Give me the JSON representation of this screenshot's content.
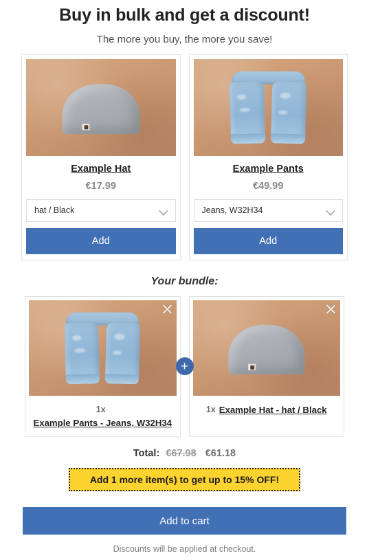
{
  "header": {
    "title": "Buy in bulk and get a discount!",
    "subtitle": "The more you buy, the more you save!"
  },
  "offers": [
    {
      "name": "Example Hat",
      "price": "€17.99",
      "variant": "hat / Black",
      "add_label": "Add",
      "image_alt": "grey-beanie-hat-photo"
    },
    {
      "name": "Example Pants",
      "price": "€49.99",
      "variant": "Jeans, W32H34",
      "add_label": "Add",
      "image_alt": "light-blue-jeans-photo"
    }
  ],
  "bundle": {
    "heading": "Your bundle:",
    "connector": "+",
    "remove_icon": "close-icon",
    "items": [
      {
        "qty": "1x",
        "name": "Example Pants - Jeans, W32H34",
        "image_alt": "light-blue-jeans-photo"
      },
      {
        "qty": "1x",
        "name": "Example Hat - hat / Black",
        "image_alt": "grey-beanie-hat-photo"
      }
    ]
  },
  "totals": {
    "label": "Total:",
    "original_price": "€67.98",
    "discounted_price": "€61.18"
  },
  "promo": {
    "message": "Add 1 more item(s) to get up to 15% OFF!"
  },
  "footer": {
    "cart_label": "Add to cart",
    "note": "Discounts will be applied at checkout."
  },
  "colors": {
    "accent_blue": "#4270b4",
    "promo_yellow": "#fdd330",
    "muted_text": "#8a8a8a"
  }
}
